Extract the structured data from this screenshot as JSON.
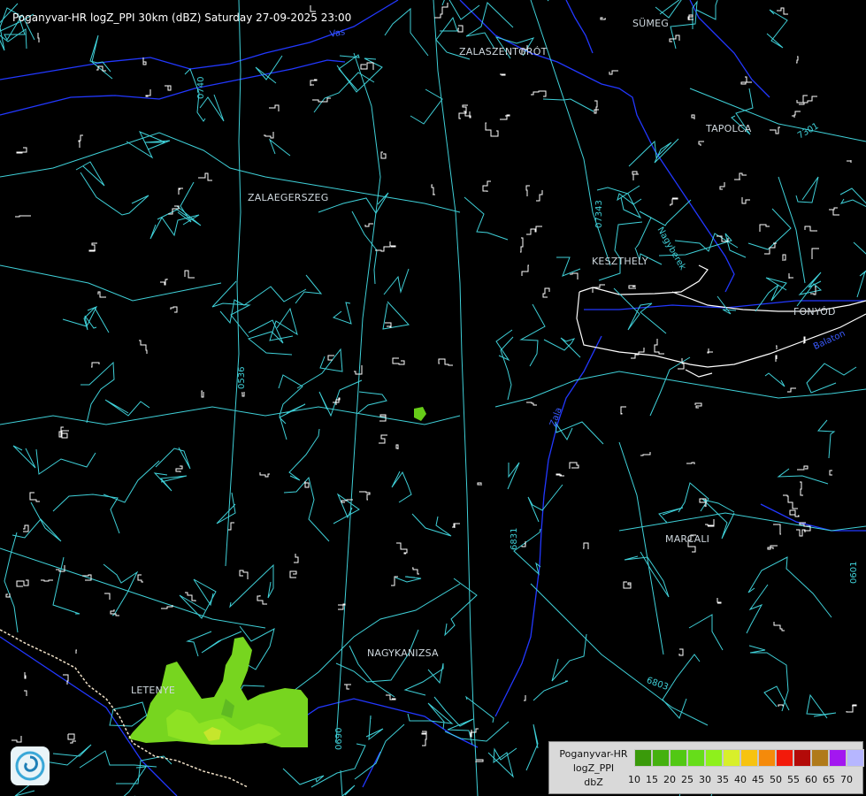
{
  "header": {
    "title": "Poganyvar-HR logZ_PPI 30km (dBZ) Saturday 27-09-2025 23:00"
  },
  "colors": {
    "background": "#000000",
    "road": "#3fd0d8",
    "river": "#2a3cff",
    "settlement_outline": "#ffffff",
    "echo_light": "#55c22a",
    "echo_mid": "#7be21f",
    "echo_bright": "#a4f01a"
  },
  "towns": [
    {
      "id": "zalaszentgrot",
      "label": "ZALASZENTGRÓT"
    },
    {
      "id": "sumeg",
      "label": "SÜMEG"
    },
    {
      "id": "tapolca",
      "label": "TAPOLCA"
    },
    {
      "id": "zalaegerszeg",
      "label": "ZALAEGERSZEG"
    },
    {
      "id": "keszthely",
      "label": "KESZTHELY"
    },
    {
      "id": "fonyod",
      "label": "FONYÓD"
    },
    {
      "id": "marcali",
      "label": "MARCALI"
    },
    {
      "id": "nagykanizsa",
      "label": "NAGYKANIZSA"
    },
    {
      "id": "letenye",
      "label": "LETENYE"
    }
  ],
  "road_labels": [
    "0740",
    "07343",
    "7301",
    "0536",
    "6831",
    "6803",
    "0690",
    "0601",
    "Nagyberek"
  ],
  "river_labels": [
    "Zala",
    "Vas",
    "Balaton"
  ],
  "legend": {
    "source_line": "Poganyvar-HR",
    "product_line": "logZ_PPI",
    "unit_line": "dbZ",
    "swatches": [
      {
        "value": 10,
        "color": "#3a9a0a"
      },
      {
        "value": 15,
        "color": "#45b10f"
      },
      {
        "value": 20,
        "color": "#52c814"
      },
      {
        "value": 25,
        "color": "#66dd1a"
      },
      {
        "value": 30,
        "color": "#8ef01c"
      },
      {
        "value": 35,
        "color": "#d8ef2a"
      },
      {
        "value": 40,
        "color": "#f7c310"
      },
      {
        "value": 45,
        "color": "#f58a0a"
      },
      {
        "value": 50,
        "color": "#f31a0a"
      },
      {
        "value": 55,
        "color": "#b30a08"
      },
      {
        "value": 60,
        "color": "#b07a1a"
      },
      {
        "value": 65,
        "color": "#a317f0"
      },
      {
        "value": 70,
        "color": "#b6b6ff"
      }
    ]
  }
}
